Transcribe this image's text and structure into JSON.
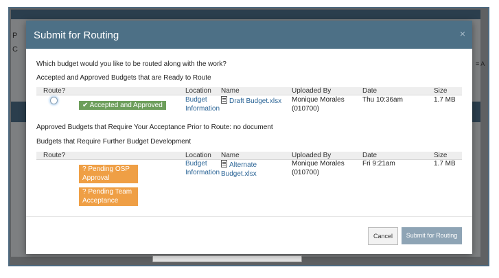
{
  "background": {
    "left_text_1": "P",
    "left_text_2": "C",
    "right_text": "≡ A"
  },
  "modal": {
    "title": "Submit for Routing",
    "close_label": "×",
    "question": "Which budget would you like to be routed along with the work?",
    "section1_title": "Accepted and Approved Budgets that are Ready to Route",
    "section2_title": "Approved Budgets that Require Your Acceptance Prior to Route: no document",
    "section3_title": "Budgets that Require Further Budget Development",
    "columns": {
      "route": "Route?",
      "location": "Location",
      "name": "Name",
      "uploaded_by": "Uploaded By",
      "date": "Date",
      "size": "Size"
    },
    "row1": {
      "status": "✔ Accepted and Approved",
      "location_line1": "Budget",
      "location_line2": "Information",
      "name": "Draft Budget.xlsx",
      "uploaded_line1": "Monique Morales",
      "uploaded_line2": "(010700)",
      "date": "Thu 10:36am",
      "size": "1.7 MB"
    },
    "row2": {
      "status1_line1": "? Pending OSP",
      "status1_line2": "Approval",
      "status2_line1": "? Pending Team",
      "status2_line2": "Acceptance",
      "location_line1": "Budget",
      "location_line2": "Information",
      "name_line1": "Alternate",
      "name_line2": "Budget.xlsx",
      "uploaded_line1": "Monique Morales",
      "uploaded_line2": "(010700)",
      "date": "Fri 9:21am",
      "size": "1.7 MB"
    },
    "buttons": {
      "cancel": "Cancel",
      "submit": "Submit for Routing"
    }
  },
  "colors": {
    "header": "#4d7086",
    "approved_badge": "#6d9e5b",
    "pending_badge": "#ef9f45",
    "link": "#2a6496",
    "submit_button": "#8ea4b5"
  }
}
